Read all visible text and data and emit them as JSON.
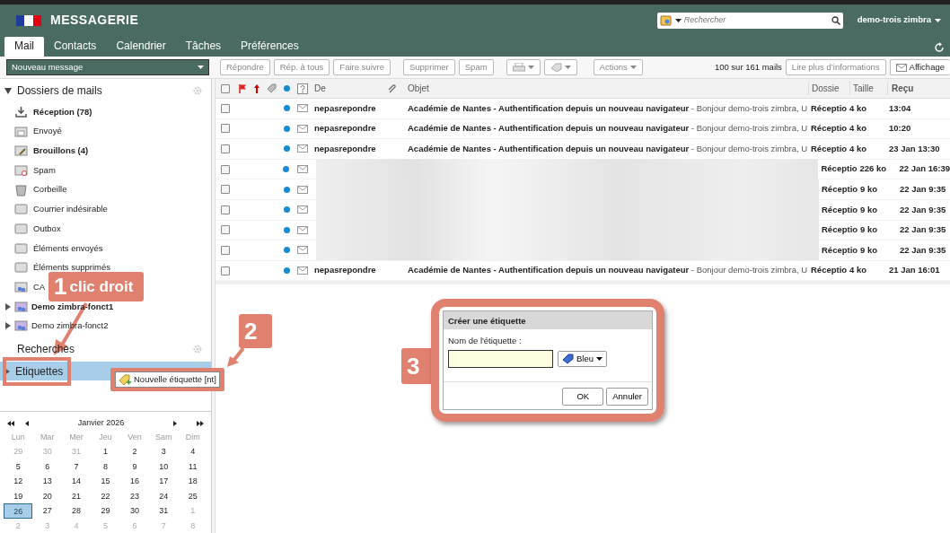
{
  "header": {
    "app_title": "MESSAGERIE",
    "search": {
      "placeholder": "Rechercher"
    },
    "user": "demo-trois zimbra"
  },
  "tabs": [
    {
      "label": "Mail",
      "selected": true
    },
    {
      "label": "Contacts",
      "selected": false
    },
    {
      "label": "Calendrier",
      "selected": false
    },
    {
      "label": "Tâches",
      "selected": false
    },
    {
      "label": "Préférences",
      "selected": false
    }
  ],
  "toolbar": {
    "new_message": "Nouveau message",
    "buttons": [
      {
        "kind": "text",
        "label": "Répondre"
      },
      {
        "kind": "text",
        "label": "Rép. à tous"
      },
      {
        "kind": "text",
        "label": "Faire suivre"
      },
      {
        "kind": "gap"
      },
      {
        "kind": "text",
        "label": "Supprimer"
      },
      {
        "kind": "text",
        "label": "Spam"
      },
      {
        "kind": "gap"
      },
      {
        "kind": "print-menu"
      },
      {
        "kind": "tag-menu"
      },
      {
        "kind": "gap"
      },
      {
        "kind": "menu",
        "label": "Actions"
      }
    ],
    "count": "100 sur 161 mails",
    "more_info": "Lire plus d’informations",
    "view": "Affichage"
  },
  "sidebar": {
    "folders_title": "Dossiers de mails",
    "folders": [
      {
        "kind": "inbox",
        "label": "Réception (78)",
        "bold": true
      },
      {
        "kind": "sent",
        "label": "Envoyé",
        "bold": false
      },
      {
        "kind": "drafts",
        "label": "Brouillons (4)",
        "bold": true
      },
      {
        "kind": "spam",
        "label": "Spam",
        "bold": false
      },
      {
        "kind": "trash",
        "label": "Corbeille",
        "bold": false
      },
      {
        "kind": "folder",
        "label": "Courrier indésirable",
        "bold": false
      },
      {
        "kind": "folder",
        "label": "Outbox",
        "bold": false
      },
      {
        "kind": "folder",
        "label": "Éléments envoyés",
        "bold": false
      },
      {
        "kind": "folder",
        "label": "Éléments supprimés",
        "bold": false
      },
      {
        "kind": "shared",
        "label": "CA",
        "bold": false
      },
      {
        "kind": "shared-group",
        "label": "Demo zimbra-fonct1",
        "bold": true
      },
      {
        "kind": "shared-group",
        "label": "Demo zimbra-fonct2",
        "bold": false
      }
    ],
    "searches_title": "Recherches",
    "tags": {
      "label": "Etiquettes",
      "selected": true
    }
  },
  "calendar": {
    "month": "Janvier 2026",
    "weekdays": [
      "Lun",
      "Mar",
      "Mer",
      "Jeu",
      "Ven",
      "Sam",
      "Dim"
    ],
    "weeks": [
      [
        {
          "day": "29",
          "outside": true,
          "selected": false
        },
        {
          "day": "30",
          "outside": true,
          "selected": false
        },
        {
          "day": "31",
          "outside": true,
          "selected": false
        },
        {
          "day": "1",
          "outside": false,
          "selected": false
        },
        {
          "day": "2",
          "outside": false,
          "selected": false
        },
        {
          "day": "3",
          "outside": false,
          "selected": false
        },
        {
          "day": "4",
          "outside": false,
          "selected": false
        }
      ],
      [
        {
          "day": "5",
          "outside": false,
          "selected": false
        },
        {
          "day": "6",
          "outside": false,
          "selected": false
        },
        {
          "day": "7",
          "outside": false,
          "selected": false
        },
        {
          "day": "8",
          "outside": false,
          "selected": false
        },
        {
          "day": "9",
          "outside": false,
          "selected": false
        },
        {
          "day": "10",
          "outside": false,
          "selected": false
        },
        {
          "day": "11",
          "outside": false,
          "selected": false
        }
      ],
      [
        {
          "day": "12",
          "outside": false,
          "selected": false
        },
        {
          "day": "13",
          "outside": false,
          "selected": false
        },
        {
          "day": "14",
          "outside": false,
          "selected": false
        },
        {
          "day": "15",
          "outside": false,
          "selected": false
        },
        {
          "day": "16",
          "outside": false,
          "selected": false
        },
        {
          "day": "17",
          "outside": false,
          "selected": false
        },
        {
          "day": "18",
          "outside": false,
          "selected": false
        }
      ],
      [
        {
          "day": "19",
          "outside": false,
          "selected": false
        },
        {
          "day": "20",
          "outside": false,
          "selected": false
        },
        {
          "day": "21",
          "outside": false,
          "selected": false
        },
        {
          "day": "22",
          "outside": false,
          "selected": false
        },
        {
          "day": "23",
          "outside": false,
          "selected": false
        },
        {
          "day": "24",
          "outside": false,
          "selected": false
        },
        {
          "day": "25",
          "outside": false,
          "selected": false
        }
      ],
      [
        {
          "day": "26",
          "outside": false,
          "selected": true
        },
        {
          "day": "27",
          "outside": false,
          "selected": false
        },
        {
          "day": "28",
          "outside": false,
          "selected": false
        },
        {
          "day": "29",
          "outside": false,
          "selected": false
        },
        {
          "day": "30",
          "outside": false,
          "selected": false
        },
        {
          "day": "31",
          "outside": false,
          "selected": false
        },
        {
          "day": "1",
          "outside": true,
          "selected": false
        }
      ],
      [
        {
          "day": "2",
          "outside": true,
          "selected": false
        },
        {
          "day": "3",
          "outside": true,
          "selected": false
        },
        {
          "day": "4",
          "outside": true,
          "selected": false
        },
        {
          "day": "5",
          "outside": true,
          "selected": false
        },
        {
          "day": "6",
          "outside": true,
          "selected": false
        },
        {
          "day": "7",
          "outside": true,
          "selected": false
        },
        {
          "day": "8",
          "outside": true,
          "selected": false
        }
      ]
    ]
  },
  "mail_list": {
    "columns": {
      "from": "De",
      "subject": "Objet",
      "folder": "Dossie",
      "size": "Taille",
      "received": "Reçu"
    },
    "select_all_checked": false,
    "rows": [
      {
        "checked": false,
        "redacted": false,
        "unread": true,
        "from": "nepasrepondre",
        "subject": "**Académie de Nantes - Authentification depuis un nouveau navigateur** - Bonjour demo-trois zimbra, U",
        "folder": "Réceptio",
        "size": "4 ko",
        "received": "13:04"
      },
      {
        "checked": false,
        "redacted": false,
        "unread": true,
        "from": "nepasrepondre",
        "subject": "**Académie de Nantes - Authentification depuis un nouveau navigateur** - Bonjour demo-trois zimbra, U",
        "folder": "Réceptio",
        "size": "4 ko",
        "received": "10:20"
      },
      {
        "checked": false,
        "redacted": false,
        "unread": true,
        "from": "nepasrepondre",
        "subject": "**Académie de Nantes - Authentification depuis un nouveau navigateur** - Bonjour demo-trois zimbra, U",
        "folder": "Réceptio",
        "size": "4 ko",
        "received": "23 Jan 13:30"
      },
      {
        "checked": false,
        "redacted": true,
        "unread": true,
        "folder": "Réceptio",
        "size": "226 ko",
        "received": "22 Jan 16:39"
      },
      {
        "checked": false,
        "redacted": true,
        "unread": true,
        "folder": "Réceptio",
        "size": "9 ko",
        "received": "22 Jan 9:35"
      },
      {
        "checked": false,
        "redacted": true,
        "unread": true,
        "folder": "Réceptio",
        "size": "9 ko",
        "received": "22 Jan 9:35"
      },
      {
        "checked": false,
        "redacted": true,
        "unread": true,
        "folder": "Réceptio",
        "size": "9 ko",
        "received": "22 Jan 9:35"
      },
      {
        "checked": false,
        "redacted": true,
        "unread": true,
        "folder": "Réceptio",
        "size": "9 ko",
        "received": "22 Jan 9:35"
      },
      {
        "checked": false,
        "redacted": false,
        "unread": true,
        "from": "nepasrepondre",
        "subject": "**Académie de Nantes - Authentification depuis un nouveau navigateur** - Bonjour demo-trois zimbra, U",
        "folder": "Réceptio",
        "size": "4 ko",
        "received": "21 Jan 16:01"
      }
    ]
  },
  "context_menu": {
    "item": "Nouvelle étiquette [nt]"
  },
  "dialog": {
    "title": "Créer une étiquette",
    "field_label": "Nom de l'étiquette :",
    "color_name": "Bleu",
    "buttons": [
      "OK",
      "Annuler"
    ]
  },
  "annotations": [
    {
      "number": "1",
      "text": "clic droit"
    },
    {
      "number": "2"
    },
    {
      "number": "3"
    }
  ]
}
